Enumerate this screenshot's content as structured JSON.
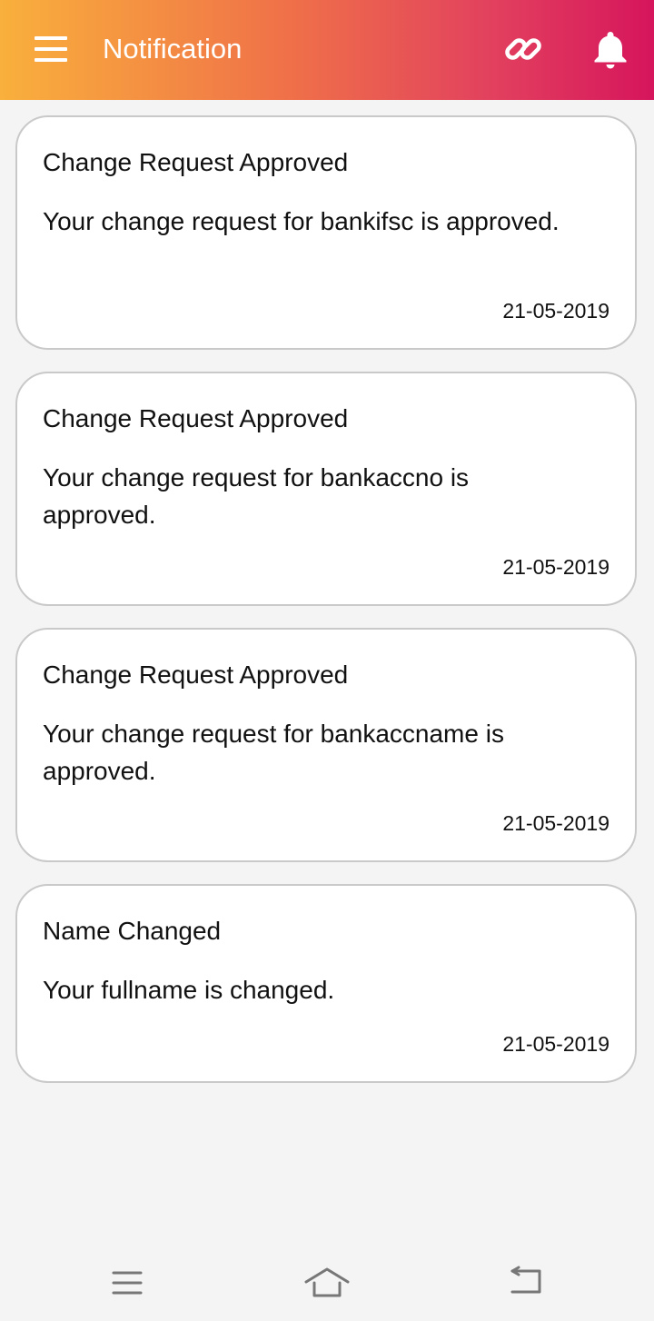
{
  "header": {
    "title": "Notification",
    "menu_icon": "hamburger-menu-icon",
    "link_icon": "link-icon",
    "bell_icon": "bell-icon",
    "gradient_colors": [
      "#f9b03c",
      "#ef6f49",
      "#e2415e",
      "#d6155c"
    ]
  },
  "notifications": [
    {
      "title": "Change Request Approved",
      "message": "Your change request for bankifsc is approved.",
      "date": "21-05-2019"
    },
    {
      "title": "Change Request Approved",
      "message": "Your change request for bankaccno is approved.",
      "date": "21-05-2019"
    },
    {
      "title": "Change Request Approved",
      "message": "Your change request for bankaccname is approved.",
      "date": "21-05-2019"
    },
    {
      "title": "Name Changed",
      "message": "Your fullname is changed.",
      "date": "21-05-2019"
    }
  ],
  "system_nav": {
    "menu_icon": "recents-menu-icon",
    "home_icon": "home-icon",
    "back_icon": "back-icon"
  }
}
